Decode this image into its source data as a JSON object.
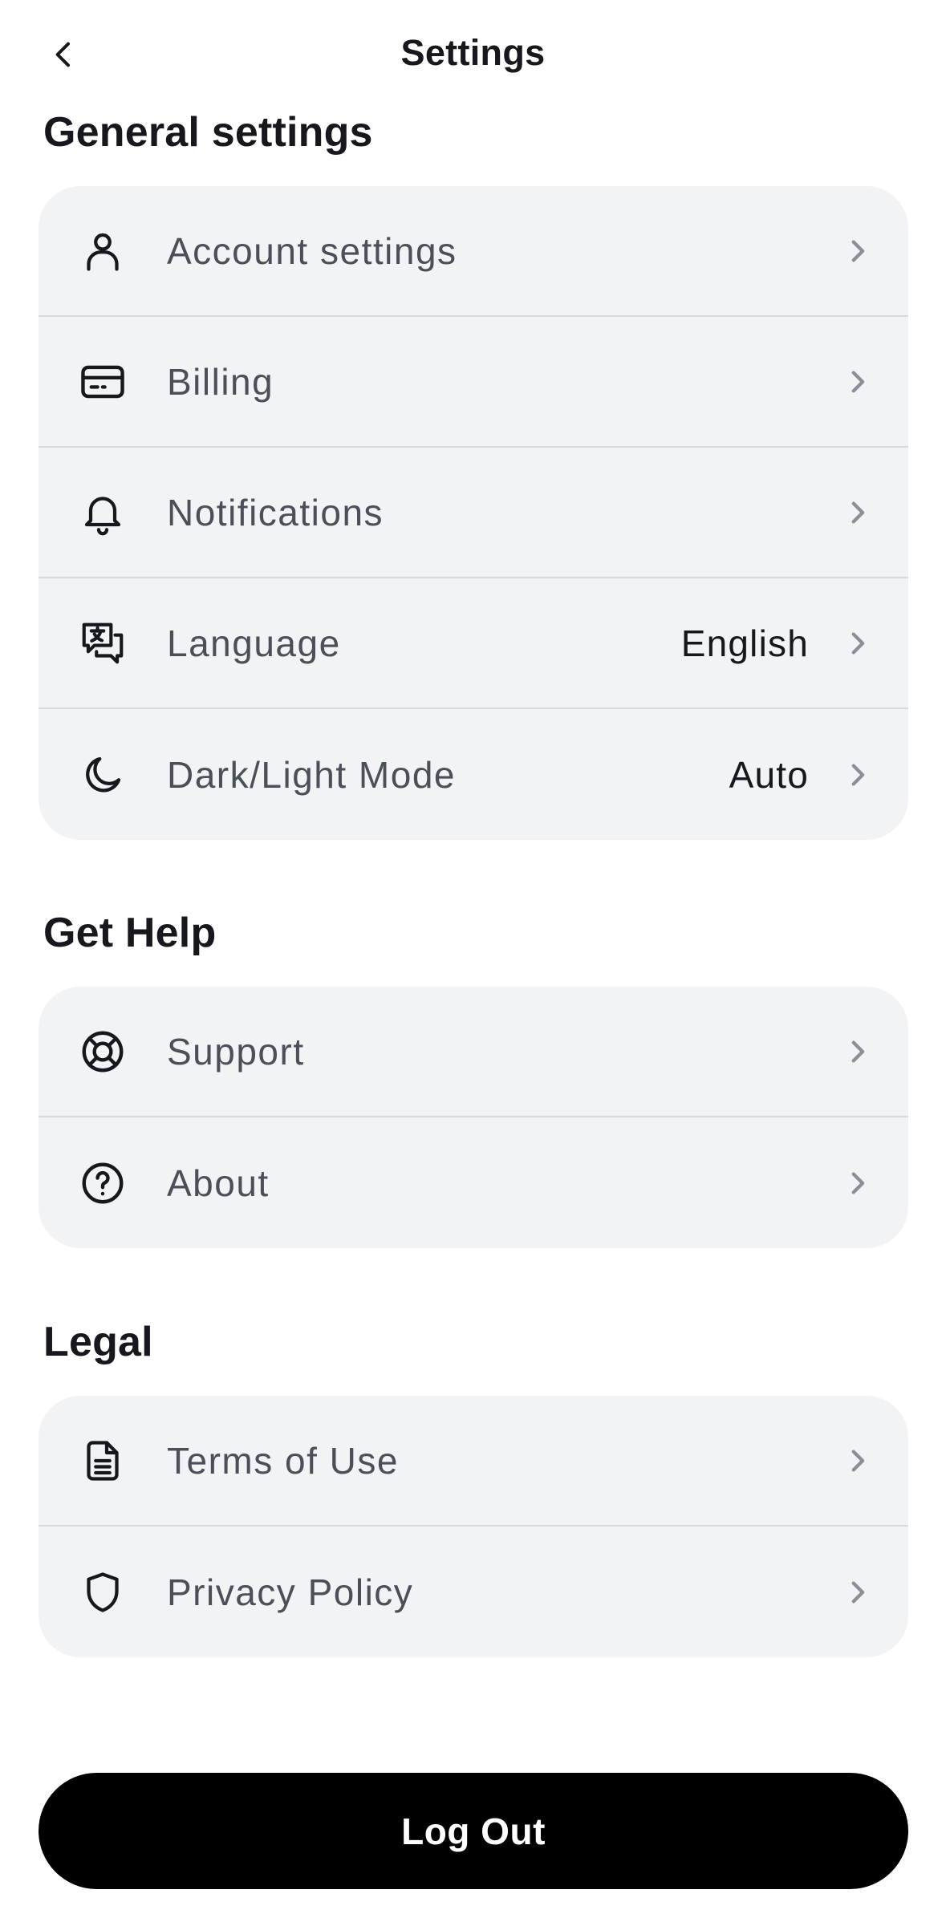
{
  "header": {
    "title": "Settings",
    "back_icon": "chevron-left-icon"
  },
  "sections": {
    "general": {
      "title": "General settings",
      "items": [
        {
          "label": "Account settings",
          "icon": "user-icon",
          "value": ""
        },
        {
          "label": "Billing",
          "icon": "credit-card-icon",
          "value": ""
        },
        {
          "label": "Notifications",
          "icon": "bell-icon",
          "value": ""
        },
        {
          "label": "Language",
          "icon": "language-icon",
          "value": "English"
        },
        {
          "label": "Dark/Light Mode",
          "icon": "moon-icon",
          "value": "Auto"
        }
      ]
    },
    "help": {
      "title": "Get Help",
      "items": [
        {
          "label": "Support",
          "icon": "lifebuoy-icon",
          "value": ""
        },
        {
          "label": "About",
          "icon": "help-circle-icon",
          "value": ""
        }
      ]
    },
    "legal": {
      "title": "Legal",
      "items": [
        {
          "label": "Terms of Use",
          "icon": "document-icon",
          "value": ""
        },
        {
          "label": "Privacy Policy",
          "icon": "shield-icon",
          "value": ""
        }
      ]
    }
  },
  "logout": {
    "label": "Log Out"
  },
  "colors": {
    "card_background": "#f2f3f5",
    "divider": "#d7d9dd",
    "label_text": "#4b4f57",
    "primary_text": "#16181d",
    "chevron": "#8a8e96",
    "logout_background": "#000000",
    "logout_text": "#ffffff"
  }
}
